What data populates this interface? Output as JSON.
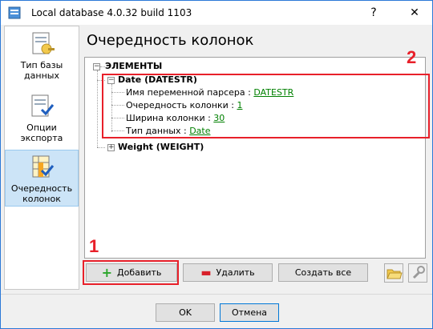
{
  "window": {
    "title": "Local database 4.0.32 build 1103",
    "help_glyph": "?",
    "close_glyph": "✕"
  },
  "nav": {
    "items": [
      {
        "label": "Тип базы данных",
        "icon": "database-type-icon",
        "selected": false
      },
      {
        "label": "Опции экспорта",
        "icon": "export-options-icon",
        "selected": false
      },
      {
        "label": "Очередность колонок",
        "icon": "column-order-icon",
        "selected": true
      }
    ]
  },
  "page_title": "Очередность колонок",
  "tree": {
    "root_label": "ЭЛЕМЕНТЫ",
    "nodes": [
      {
        "label": "Date (DATESTR)",
        "expanded": true,
        "props": [
          {
            "label": "Имя переменной парсера : ",
            "value": "DATESTR"
          },
          {
            "label": "Очередность колонки : ",
            "value": "1"
          },
          {
            "label": "Ширина колонки : ",
            "value": "30"
          },
          {
            "label": "Тип данных : ",
            "value": "Date"
          }
        ]
      },
      {
        "label": "Weight (WEIGHT)",
        "expanded": false
      }
    ]
  },
  "annotations": {
    "marker_1": "1",
    "marker_2": "2",
    "color": "#e8202a"
  },
  "buttons": {
    "add": "Добавить",
    "delete": "Удалить",
    "create_all": "Создать все",
    "ok": "OK",
    "cancel": "Отмена"
  },
  "colors": {
    "link": "#008000",
    "selection": "#cce4f7",
    "accent": "#2b79d8"
  }
}
